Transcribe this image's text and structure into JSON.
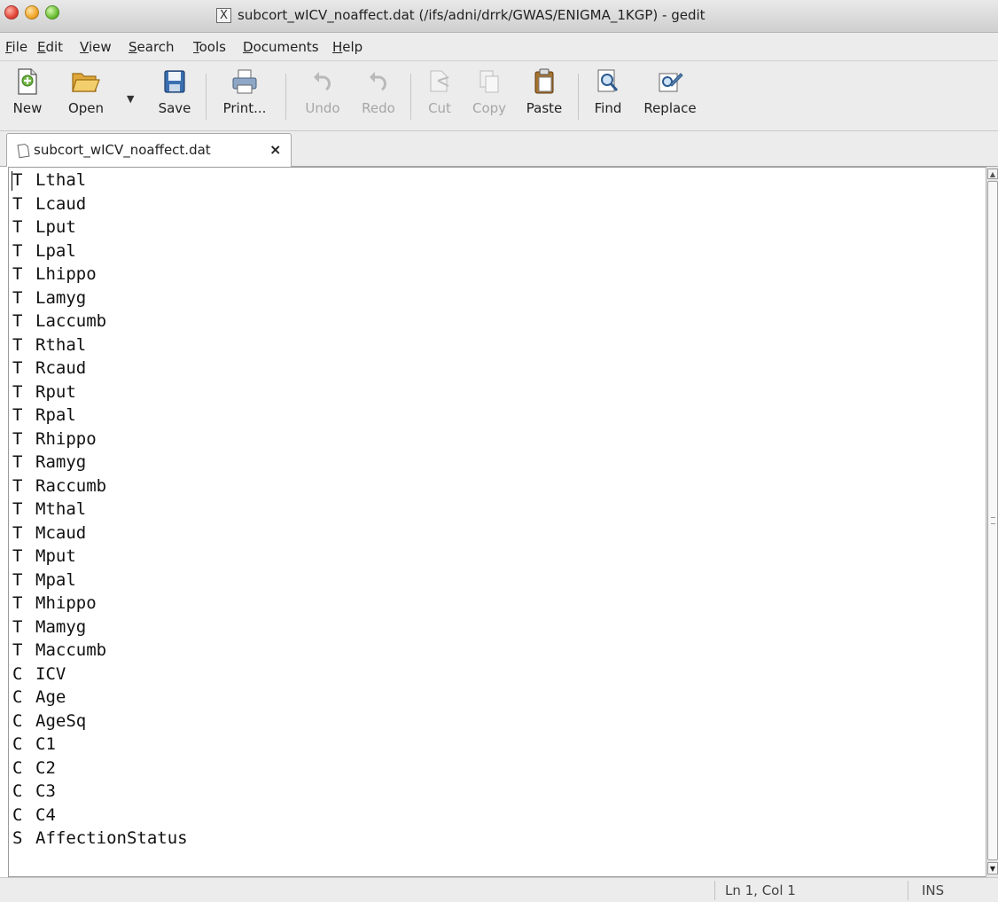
{
  "window": {
    "title": "subcort_wICV_noaffect.dat (/ifs/adni/drrk/GWAS/ENIGMA_1KGP) - gedit",
    "app_icon": "x11-icon",
    "title_icon_glyph": "X"
  },
  "menubar": {
    "items": [
      {
        "accel": "F",
        "rest": "ile"
      },
      {
        "accel": "E",
        "rest": "dit"
      },
      {
        "accel": "V",
        "rest": "iew"
      },
      {
        "accel": "S",
        "rest": "earch"
      },
      {
        "accel": "T",
        "rest": "ools"
      },
      {
        "accel": "D",
        "rest": "ocuments"
      },
      {
        "accel": "H",
        "rest": "elp"
      }
    ]
  },
  "toolbar": {
    "new_label": "New",
    "open_label": "Open",
    "save_label": "Save",
    "print_label": "Print...",
    "undo_label": "Undo",
    "redo_label": "Redo",
    "cut_label": "Cut",
    "copy_label": "Copy",
    "paste_label": "Paste",
    "find_label": "Find",
    "replace_label": "Replace",
    "disabled": [
      "Undo",
      "Redo",
      "Cut",
      "Copy"
    ]
  },
  "tab": {
    "label": "subcort_wICV_noaffect.dat",
    "close_glyph": "×"
  },
  "editor": {
    "lines": [
      {
        "code": "T",
        "name": "Lthal"
      },
      {
        "code": "T",
        "name": "Lcaud"
      },
      {
        "code": "T",
        "name": "Lput"
      },
      {
        "code": "T",
        "name": "Lpal"
      },
      {
        "code": "T",
        "name": "Lhippo"
      },
      {
        "code": "T",
        "name": "Lamyg"
      },
      {
        "code": "T",
        "name": "Laccumb"
      },
      {
        "code": "T",
        "name": "Rthal"
      },
      {
        "code": "T",
        "name": "Rcaud"
      },
      {
        "code": "T",
        "name": "Rput"
      },
      {
        "code": "T",
        "name": "Rpal"
      },
      {
        "code": "T",
        "name": "Rhippo"
      },
      {
        "code": "T",
        "name": "Ramyg"
      },
      {
        "code": "T",
        "name": "Raccumb"
      },
      {
        "code": "T",
        "name": "Mthal"
      },
      {
        "code": "T",
        "name": "Mcaud"
      },
      {
        "code": "T",
        "name": "Mput"
      },
      {
        "code": "T",
        "name": "Mpal"
      },
      {
        "code": "T",
        "name": "Mhippo"
      },
      {
        "code": "T",
        "name": "Mamyg"
      },
      {
        "code": "T",
        "name": "Maccumb"
      },
      {
        "code": "C",
        "name": "ICV"
      },
      {
        "code": "C",
        "name": "Age"
      },
      {
        "code": "C",
        "name": "AgeSq"
      },
      {
        "code": "C",
        "name": "C1"
      },
      {
        "code": "C",
        "name": "C2"
      },
      {
        "code": "C",
        "name": "C3"
      },
      {
        "code": "C",
        "name": "C4"
      },
      {
        "code": "S",
        "name": "AffectionStatus"
      }
    ]
  },
  "statusbar": {
    "position": "Ln 1, Col 1",
    "mode": "INS"
  },
  "colors": {
    "chrome_bg": "#ececec",
    "editor_bg": "#ffffff",
    "disabled_text": "#a6a6a6"
  }
}
